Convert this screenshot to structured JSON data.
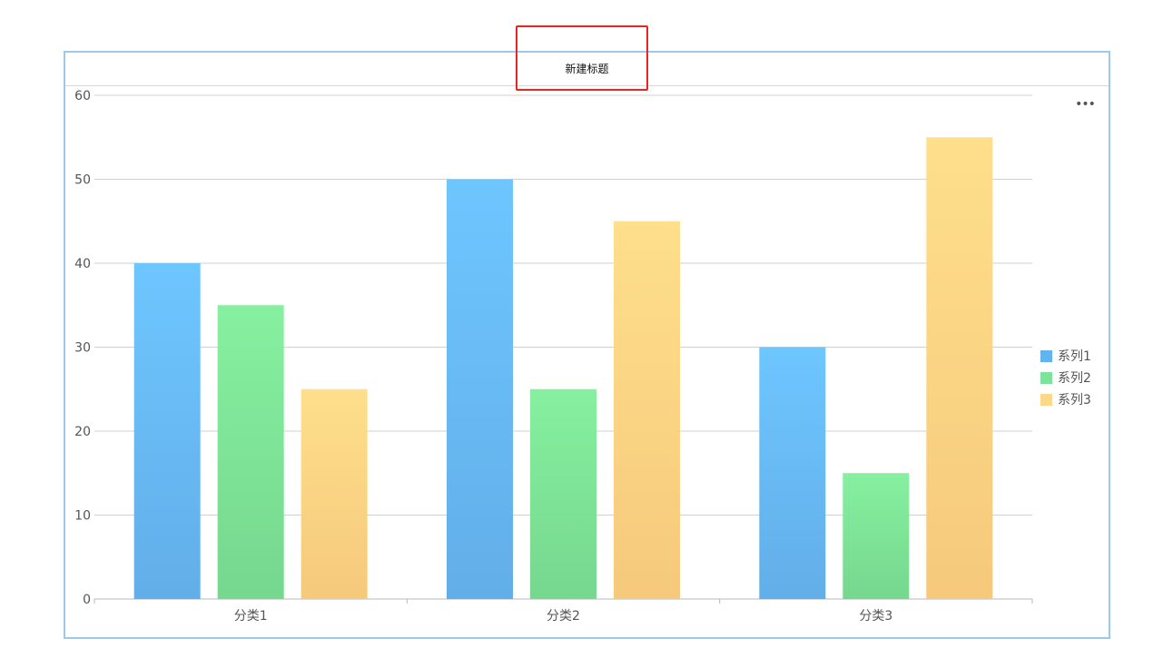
{
  "widget": {
    "title": "新建标题",
    "more_icon": "more-icon",
    "more_glyph": "•••"
  },
  "chart_data": {
    "type": "bar",
    "title": "新建标题",
    "categories": [
      "分类1",
      "分类2",
      "分类3"
    ],
    "series": [
      {
        "name": "系列1",
        "values": [
          40,
          50,
          30
        ],
        "color_top": "#6ec6ff",
        "color_bottom": "#62aee9"
      },
      {
        "name": "系列2",
        "values": [
          35,
          25,
          15
        ],
        "color_top": "#86f0a0",
        "color_bottom": "#76d78e"
      },
      {
        "name": "系列3",
        "values": [
          25,
          45,
          55
        ],
        "color_top": "#fedf8b",
        "color_bottom": "#f6c97c"
      }
    ],
    "ylim": [
      0,
      60
    ],
    "yticks": [
      0,
      10,
      20,
      30,
      40,
      50,
      60
    ],
    "xlabel": "",
    "ylabel": "",
    "grid": true,
    "legend_position": "right"
  },
  "legend": {
    "swatch_colors": [
      "#62b4f0",
      "#7ee39a",
      "#fcd98a"
    ]
  }
}
